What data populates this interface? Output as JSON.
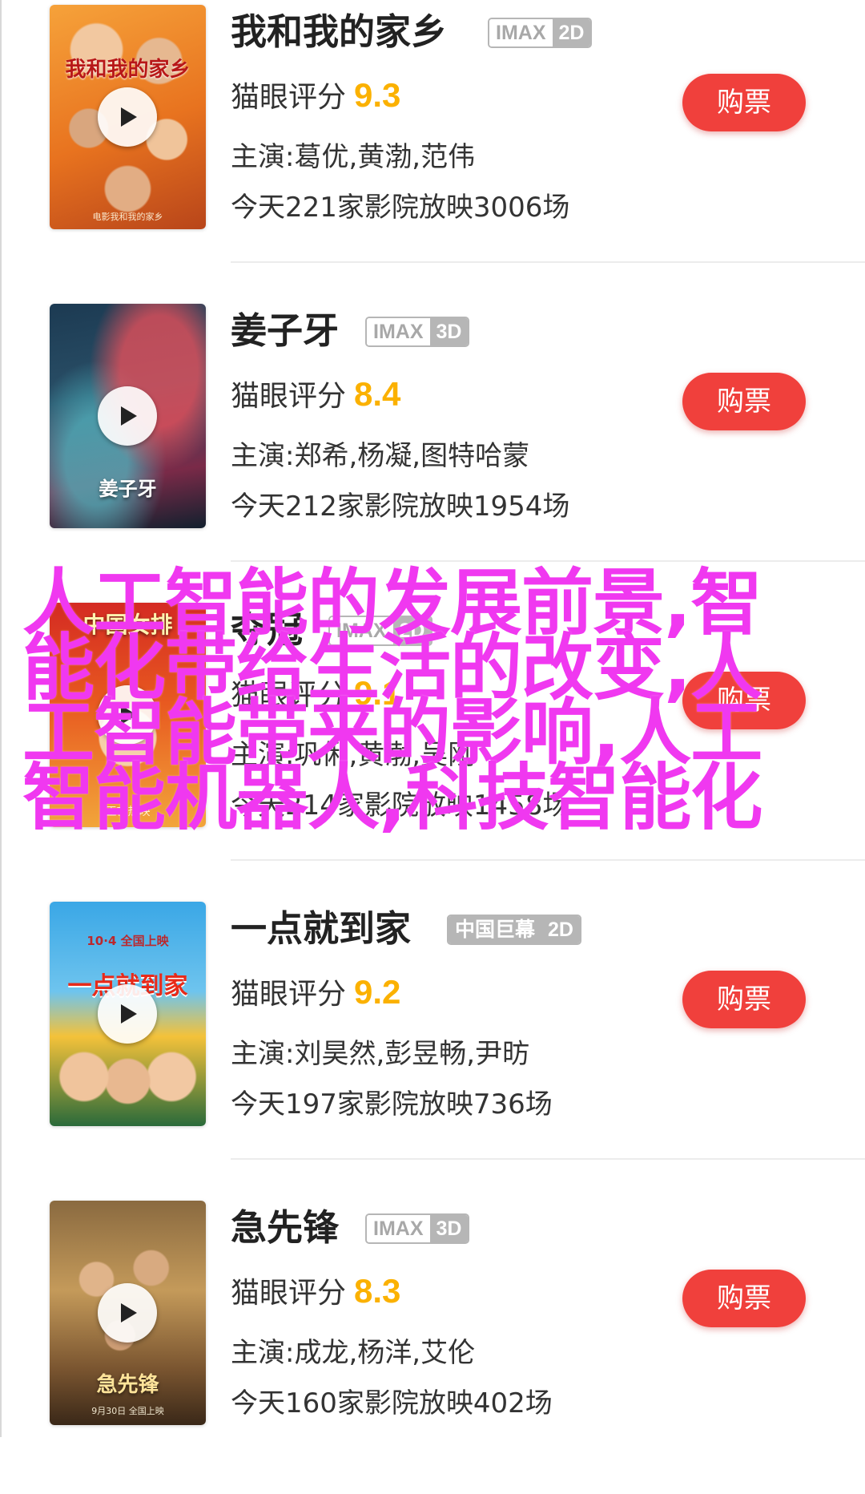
{
  "colors": {
    "buy_button": "#f0403c",
    "score": "#fbb100",
    "overlay_text": "#f038f0",
    "badge_gray": "#b6b6b6"
  },
  "rating_label": "猫眼评分",
  "movies": [
    {
      "title": "我和我的家乡",
      "format": "IMAX",
      "dimension": "2D",
      "score": "9.3",
      "cast": "主演:葛优,黄渤,范伟",
      "shows": "今天221家影院放映3006场",
      "buy_label": "购票"
    },
    {
      "title": "姜子牙",
      "format": "IMAX",
      "dimension": "3D",
      "score": "8.4",
      "cast": "主演:郑希,杨凝,图特哈蒙",
      "shows": "今天212家影院放映1954场",
      "buy_label": "购票"
    },
    {
      "title": "夺冠",
      "format": "IMAX",
      "dimension": "2D",
      "score": "9.1",
      "cast": "主演:巩俐,黄渤,吴刚",
      "shows": "今天214家影院放映1458场",
      "buy_label": "购票"
    },
    {
      "title": "一点就到家",
      "format": "中国巨幕",
      "dimension": "2D",
      "score": "9.2",
      "cast": "主演:刘昊然,彭昱畅,尹昉",
      "shows": "今天197家影院放映736场",
      "buy_label": "购票"
    },
    {
      "title": "急先锋",
      "format": "IMAX",
      "dimension": "3D",
      "score": "8.3",
      "cast": "主演:成龙,杨洋,艾伦",
      "shows": "今天160家影院放映402场",
      "buy_label": "购票"
    }
  ],
  "posters": [
    {
      "title": "我和我的家乡",
      "sub": "电影我和我的家乡"
    },
    {
      "title": "姜子牙",
      "sub": ""
    },
    {
      "title": "中国女排",
      "sub": "正在热映"
    },
    {
      "title": "一点就到家",
      "sub": "10·4 全国上映"
    },
    {
      "title": "急先锋",
      "sub": "9月30日 全国上映"
    }
  ],
  "overlay_text": "人工智能的发展前景,智能化带给生活的改变,人工智能带来的影响,人工智能机器人,科技智能化"
}
